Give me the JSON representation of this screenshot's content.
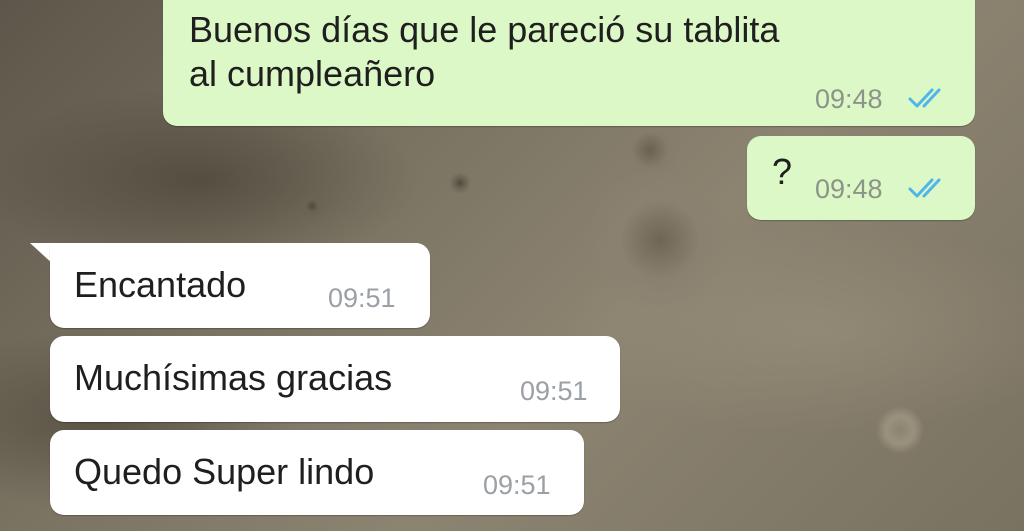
{
  "chat": {
    "messages": [
      {
        "direction": "outgoing",
        "text_line1": "Buenos días que le pareció su tablita",
        "text_line2": "al cumpleañero",
        "time": "09:48",
        "status_icon": "double-check-read-icon"
      },
      {
        "direction": "outgoing",
        "text": "?",
        "time": "09:48",
        "status_icon": "double-check-read-icon"
      },
      {
        "direction": "incoming",
        "text": "Encantado",
        "time": "09:51"
      },
      {
        "direction": "incoming",
        "text": "Muchísimas gracias",
        "time": "09:51"
      },
      {
        "direction": "incoming",
        "text": "Quedo Super lindo",
        "time": "09:51"
      }
    ]
  },
  "colors": {
    "outgoing_bubble": "#dcf8c6",
    "incoming_bubble": "#ffffff",
    "read_ticks": "#4fb6ec",
    "timestamp": "#8c948a",
    "text": "#1f1f1f"
  }
}
